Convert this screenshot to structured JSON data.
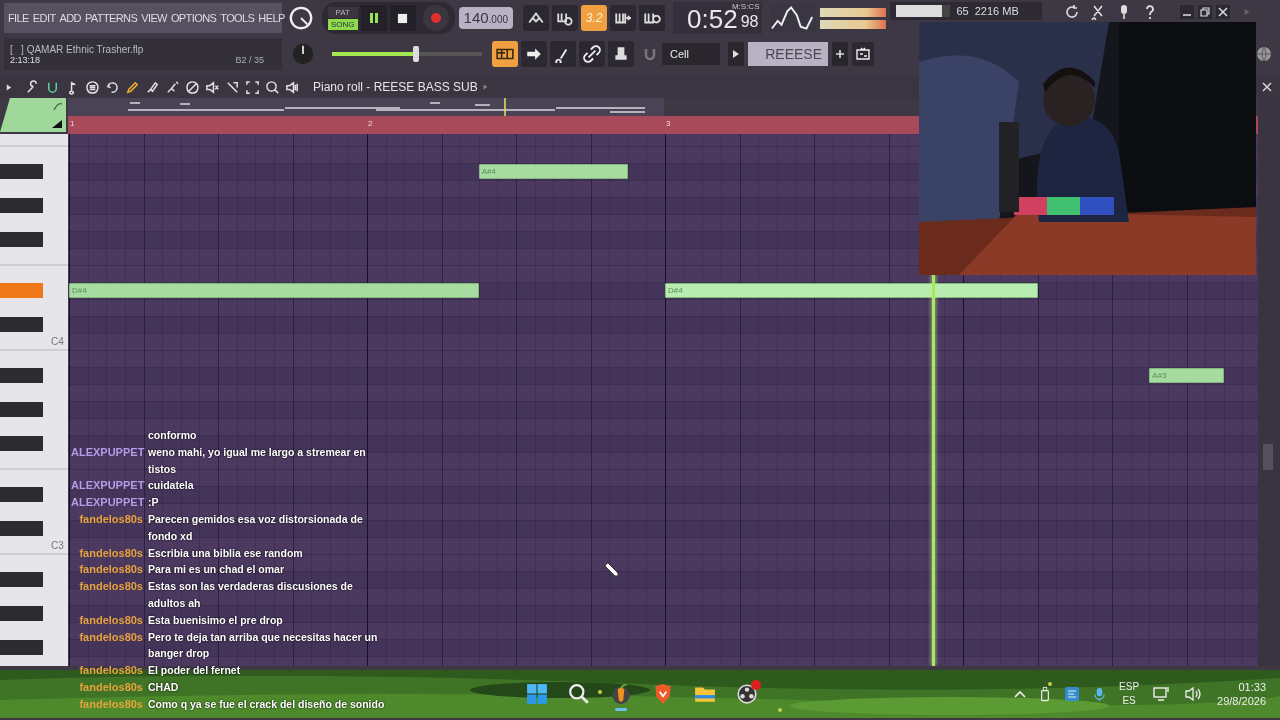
{
  "menu": [
    "FILE",
    "EDIT",
    "ADD",
    "PATTERNS",
    "VIEW",
    "OPTIONS",
    "TOOLS",
    "HELP"
  ],
  "transport": {
    "modes": [
      {
        "label": "PAT",
        "selected": false
      },
      {
        "label": "SONG",
        "selected": true
      }
    ],
    "playing": true,
    "tempo": "140",
    "tempo_decimals": ".000",
    "countdown": "3.2"
  },
  "clock": {
    "unit": "M:S:CS",
    "time": "0:52",
    "centiseconds": "98"
  },
  "cpu": {
    "level": 0.85,
    "reading": "65"
  },
  "memory": "2216 MB",
  "project": {
    "file": "[   ] QAMAR Ethnic Trasher.flp",
    "time": "2:13:18",
    "position": "B2 / 35"
  },
  "master_volume": {
    "level": 0.56
  },
  "snap": "Cell",
  "pattern": "REEESE",
  "piano_roll": {
    "title": "Piano roll - REESE BASS SUB",
    "bars": [
      "1",
      "2",
      "3"
    ],
    "key_labels": [
      "C4",
      "C3"
    ],
    "notes": [
      {
        "label": "A#4",
        "playing": false
      },
      {
        "label": "D#4",
        "playing": false
      },
      {
        "label": "D#4",
        "playing": true
      },
      {
        "label": "A#3",
        "playing": false
      }
    ]
  },
  "chat": [
    {
      "text": "conformo"
    },
    {
      "user": "ALEXPUPPET",
      "color": "#b49ce6",
      "text": "weno mahi, yo igual me largo a stremear en tistos"
    },
    {
      "user": "ALEXPUPPET",
      "color": "#b49ce6",
      "text": "cuidatela"
    },
    {
      "user": "ALEXPUPPET",
      "color": "#b49ce6",
      "text": ":P"
    },
    {
      "user": "fandelos80s",
      "color": "#e6a23c",
      "text": "Parecen gemidos esa voz distorsionada de fondo xd"
    },
    {
      "user": "fandelos80s",
      "color": "#e6a23c",
      "text": "Escribia una biblia ese random"
    },
    {
      "user": "fandelos80s",
      "color": "#e6a23c",
      "text": "Para mi es un chad el omar"
    },
    {
      "user": "fandelos80s",
      "color": "#e6a23c",
      "text": "Estas son las verdaderas discusiones de adultos ah"
    },
    {
      "user": "fandelos80s",
      "color": "#e6a23c",
      "text": "Esta buenisimo el pre drop"
    },
    {
      "user": "fandelos80s",
      "color": "#e6a23c",
      "text": "Pero te deja tan arriba que necesitas hacer un banger drop"
    },
    {
      "user": "fandelos80s",
      "color": "#e6a23c",
      "text": "El poder del fernet"
    },
    {
      "user": "fandelos80s",
      "color": "#e6a23c",
      "text": "CHAD"
    },
    {
      "user": "fandelos80s",
      "color": "#e6a23c",
      "text": "Como q ya se fue el crack del diseño de sonido"
    }
  ],
  "taskbar": {
    "language": "ESP",
    "layout": "ES",
    "time": "01:33",
    "date": "29/8/2026"
  }
}
